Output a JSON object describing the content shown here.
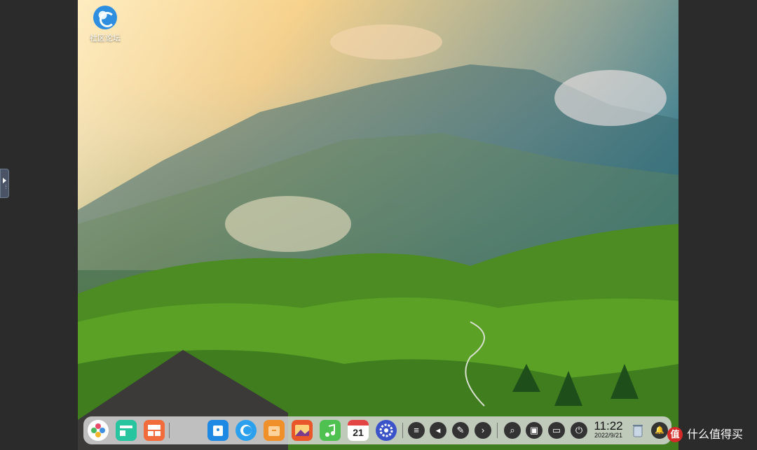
{
  "desktop": {
    "icons": [
      {
        "label": "社区论坛",
        "icon": "deepin-forum-icon"
      }
    ]
  },
  "dock": {
    "apps": [
      {
        "name": "launcher",
        "icon": "launcher-icon",
        "color": "#ffffff"
      },
      {
        "name": "multitasking",
        "icon": "multitask-view-icon",
        "color": "#27c4a0"
      },
      {
        "name": "workspaces",
        "icon": "workspace-icon",
        "color": "#f26b3a"
      },
      {
        "name": "app-store",
        "icon": "app-store-icon",
        "color": "#1e88e5"
      },
      {
        "name": "browser",
        "icon": "browser-icon",
        "color": "#2aa0ef"
      },
      {
        "name": "file-manager",
        "icon": "folder-icon",
        "color": "#f0902a"
      },
      {
        "name": "photos",
        "icon": "photos-icon",
        "color": "#e8562a"
      },
      {
        "name": "music",
        "icon": "music-icon",
        "color": "#4fc150"
      },
      {
        "name": "calendar",
        "icon": "calendar-icon",
        "color": "#ffffff",
        "day": "21"
      },
      {
        "name": "settings",
        "icon": "settings-icon",
        "color": "#3a53c9"
      }
    ],
    "tray": [
      {
        "name": "notes",
        "icon": "list-icon",
        "glyph": "≡"
      },
      {
        "name": "volume",
        "icon": "volume-icon",
        "glyph": "◂"
      },
      {
        "name": "screenshot-pen",
        "icon": "pen-icon",
        "glyph": "✎"
      },
      {
        "name": "expand",
        "icon": "chevron-right-icon",
        "glyph": "›"
      },
      {
        "name": "search",
        "icon": "search-icon",
        "glyph": "⌕"
      },
      {
        "name": "screen-capture",
        "icon": "capture-icon",
        "glyph": "▣"
      },
      {
        "name": "display",
        "icon": "display-icon",
        "glyph": "▭"
      },
      {
        "name": "power",
        "icon": "power-icon",
        "glyph": "⏻"
      }
    ],
    "clock": {
      "time": "11:22",
      "date": "2022/9/21"
    },
    "trash": {
      "icon": "trash-icon"
    },
    "notifications": {
      "icon": "bell-icon",
      "glyph": "🔔"
    }
  },
  "watermark": {
    "badge": "值",
    "text": "什么值得买"
  }
}
